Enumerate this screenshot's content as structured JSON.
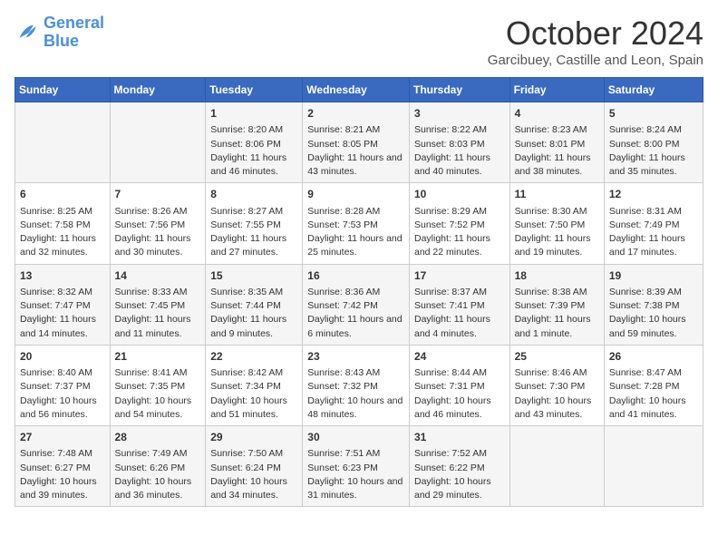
{
  "logo": {
    "line1": "General",
    "line2": "Blue"
  },
  "title": "October 2024",
  "subtitle": "Garcibuey, Castille and Leon, Spain",
  "days_of_week": [
    "Sunday",
    "Monday",
    "Tuesday",
    "Wednesday",
    "Thursday",
    "Friday",
    "Saturday"
  ],
  "weeks": [
    [
      {
        "day": "",
        "info": ""
      },
      {
        "day": "",
        "info": ""
      },
      {
        "day": "1",
        "info": "Sunrise: 8:20 AM\nSunset: 8:06 PM\nDaylight: 11 hours and 46 minutes."
      },
      {
        "day": "2",
        "info": "Sunrise: 8:21 AM\nSunset: 8:05 PM\nDaylight: 11 hours and 43 minutes."
      },
      {
        "day": "3",
        "info": "Sunrise: 8:22 AM\nSunset: 8:03 PM\nDaylight: 11 hours and 40 minutes."
      },
      {
        "day": "4",
        "info": "Sunrise: 8:23 AM\nSunset: 8:01 PM\nDaylight: 11 hours and 38 minutes."
      },
      {
        "day": "5",
        "info": "Sunrise: 8:24 AM\nSunset: 8:00 PM\nDaylight: 11 hours and 35 minutes."
      }
    ],
    [
      {
        "day": "6",
        "info": "Sunrise: 8:25 AM\nSunset: 7:58 PM\nDaylight: 11 hours and 32 minutes."
      },
      {
        "day": "7",
        "info": "Sunrise: 8:26 AM\nSunset: 7:56 PM\nDaylight: 11 hours and 30 minutes."
      },
      {
        "day": "8",
        "info": "Sunrise: 8:27 AM\nSunset: 7:55 PM\nDaylight: 11 hours and 27 minutes."
      },
      {
        "day": "9",
        "info": "Sunrise: 8:28 AM\nSunset: 7:53 PM\nDaylight: 11 hours and 25 minutes."
      },
      {
        "day": "10",
        "info": "Sunrise: 8:29 AM\nSunset: 7:52 PM\nDaylight: 11 hours and 22 minutes."
      },
      {
        "day": "11",
        "info": "Sunrise: 8:30 AM\nSunset: 7:50 PM\nDaylight: 11 hours and 19 minutes."
      },
      {
        "day": "12",
        "info": "Sunrise: 8:31 AM\nSunset: 7:49 PM\nDaylight: 11 hours and 17 minutes."
      }
    ],
    [
      {
        "day": "13",
        "info": "Sunrise: 8:32 AM\nSunset: 7:47 PM\nDaylight: 11 hours and 14 minutes."
      },
      {
        "day": "14",
        "info": "Sunrise: 8:33 AM\nSunset: 7:45 PM\nDaylight: 11 hours and 11 minutes."
      },
      {
        "day": "15",
        "info": "Sunrise: 8:35 AM\nSunset: 7:44 PM\nDaylight: 11 hours and 9 minutes."
      },
      {
        "day": "16",
        "info": "Sunrise: 8:36 AM\nSunset: 7:42 PM\nDaylight: 11 hours and 6 minutes."
      },
      {
        "day": "17",
        "info": "Sunrise: 8:37 AM\nSunset: 7:41 PM\nDaylight: 11 hours and 4 minutes."
      },
      {
        "day": "18",
        "info": "Sunrise: 8:38 AM\nSunset: 7:39 PM\nDaylight: 11 hours and 1 minute."
      },
      {
        "day": "19",
        "info": "Sunrise: 8:39 AM\nSunset: 7:38 PM\nDaylight: 10 hours and 59 minutes."
      }
    ],
    [
      {
        "day": "20",
        "info": "Sunrise: 8:40 AM\nSunset: 7:37 PM\nDaylight: 10 hours and 56 minutes."
      },
      {
        "day": "21",
        "info": "Sunrise: 8:41 AM\nSunset: 7:35 PM\nDaylight: 10 hours and 54 minutes."
      },
      {
        "day": "22",
        "info": "Sunrise: 8:42 AM\nSunset: 7:34 PM\nDaylight: 10 hours and 51 minutes."
      },
      {
        "day": "23",
        "info": "Sunrise: 8:43 AM\nSunset: 7:32 PM\nDaylight: 10 hours and 48 minutes."
      },
      {
        "day": "24",
        "info": "Sunrise: 8:44 AM\nSunset: 7:31 PM\nDaylight: 10 hours and 46 minutes."
      },
      {
        "day": "25",
        "info": "Sunrise: 8:46 AM\nSunset: 7:30 PM\nDaylight: 10 hours and 43 minutes."
      },
      {
        "day": "26",
        "info": "Sunrise: 8:47 AM\nSunset: 7:28 PM\nDaylight: 10 hours and 41 minutes."
      }
    ],
    [
      {
        "day": "27",
        "info": "Sunrise: 7:48 AM\nSunset: 6:27 PM\nDaylight: 10 hours and 39 minutes."
      },
      {
        "day": "28",
        "info": "Sunrise: 7:49 AM\nSunset: 6:26 PM\nDaylight: 10 hours and 36 minutes."
      },
      {
        "day": "29",
        "info": "Sunrise: 7:50 AM\nSunset: 6:24 PM\nDaylight: 10 hours and 34 minutes."
      },
      {
        "day": "30",
        "info": "Sunrise: 7:51 AM\nSunset: 6:23 PM\nDaylight: 10 hours and 31 minutes."
      },
      {
        "day": "31",
        "info": "Sunrise: 7:52 AM\nSunset: 6:22 PM\nDaylight: 10 hours and 29 minutes."
      },
      {
        "day": "",
        "info": ""
      },
      {
        "day": "",
        "info": ""
      }
    ]
  ]
}
